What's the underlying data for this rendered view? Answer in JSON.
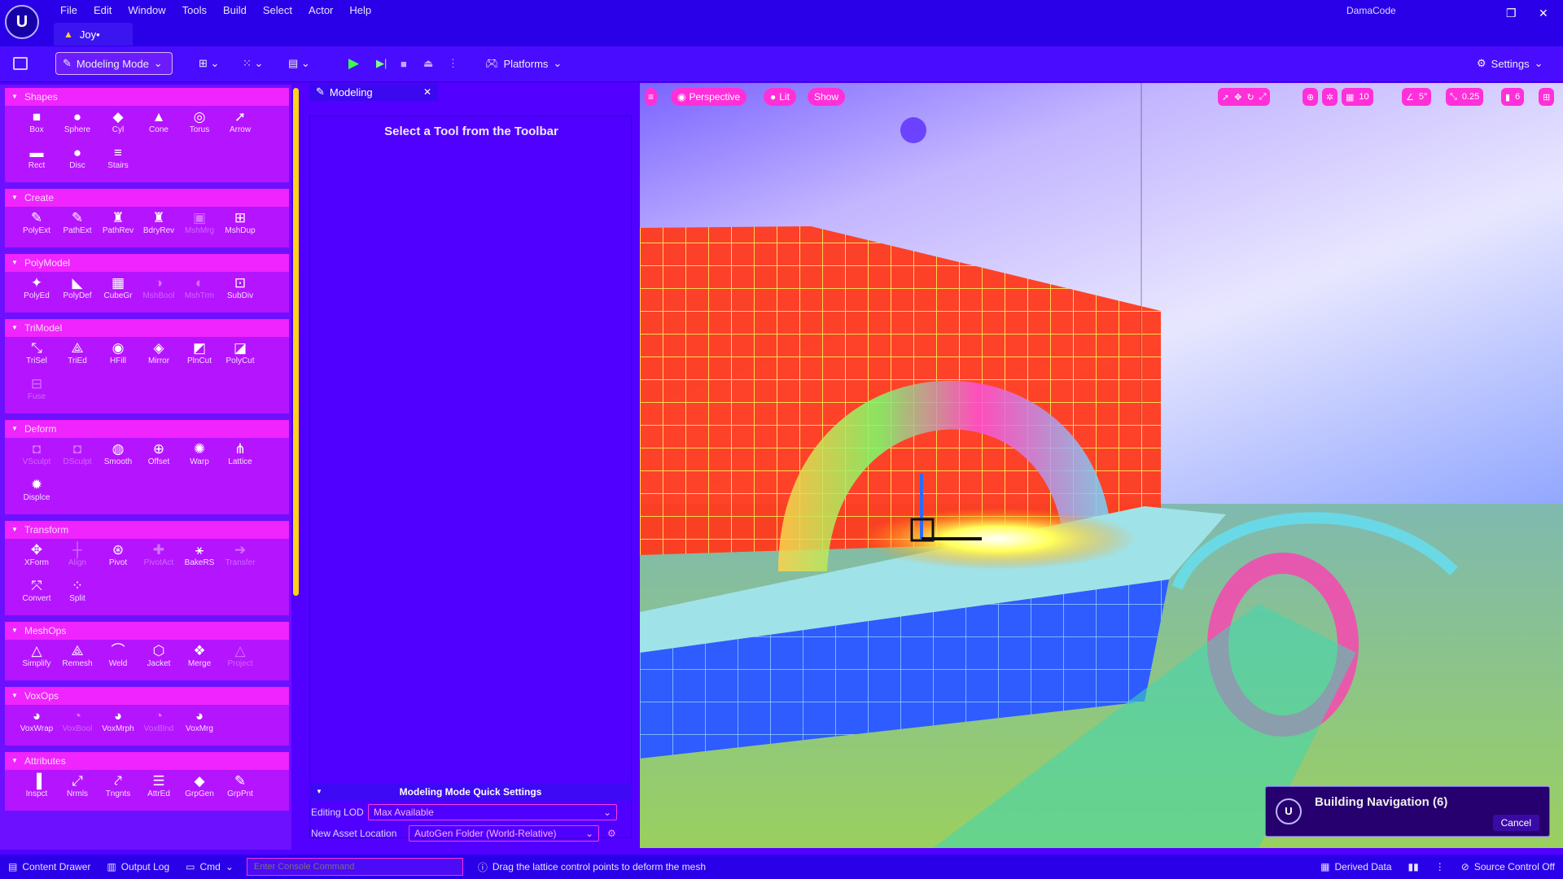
{
  "app": {
    "menu": [
      "File",
      "Edit",
      "Window",
      "Tools",
      "Build",
      "Select",
      "Actor",
      "Help"
    ],
    "document_tab": "Joy•",
    "project_name": "DamaCode"
  },
  "toolbar": {
    "mode_label": "Modeling Mode",
    "platforms_label": "Platforms",
    "settings_label": "Settings"
  },
  "palette": {
    "sections": [
      {
        "title": "Shapes",
        "tools": [
          {
            "label": "Box",
            "icon": "box-icon",
            "glyph": "■"
          },
          {
            "label": "Sphere",
            "icon": "sphere-icon",
            "glyph": "●"
          },
          {
            "label": "Cyl",
            "icon": "cylinder-icon",
            "glyph": "◆"
          },
          {
            "label": "Cone",
            "icon": "cone-icon",
            "glyph": "▲"
          },
          {
            "label": "Torus",
            "icon": "torus-icon",
            "glyph": "◎"
          },
          {
            "label": "Arrow",
            "icon": "arrow-icon",
            "glyph": "➚"
          },
          {
            "label": "Rect",
            "icon": "rect-icon",
            "glyph": "▬"
          },
          {
            "label": "Disc",
            "icon": "disc-icon",
            "glyph": "●"
          },
          {
            "label": "Stairs",
            "icon": "stairs-icon",
            "glyph": "≡"
          }
        ]
      },
      {
        "title": "Create",
        "tools": [
          {
            "label": "PolyExt",
            "icon": "pen-icon",
            "glyph": "✎"
          },
          {
            "label": "PathExt",
            "icon": "pen-icon",
            "glyph": "✎"
          },
          {
            "label": "PathRev",
            "icon": "revolve-icon",
            "glyph": "♜"
          },
          {
            "label": "BdryRev",
            "icon": "revolve-icon",
            "glyph": "♜"
          },
          {
            "label": "MshMrg",
            "icon": "merge-icon",
            "glyph": "▣",
            "dim": true
          },
          {
            "label": "MshDup",
            "icon": "duplicate-icon",
            "glyph": "⊞"
          }
        ]
      },
      {
        "title": "PolyModel",
        "tools": [
          {
            "label": "PolyEd",
            "icon": "polyedit-icon",
            "glyph": "✦"
          },
          {
            "label": "PolyDef",
            "icon": "polydeform-icon",
            "glyph": "◣"
          },
          {
            "label": "CubeGr",
            "icon": "cubegrid-icon",
            "glyph": "▦"
          },
          {
            "label": "MshBool",
            "icon": "boolean-icon",
            "glyph": "◑",
            "dim": true
          },
          {
            "label": "MshTrm",
            "icon": "trim-icon",
            "glyph": "◐",
            "dim": true
          },
          {
            "label": "SubDiv",
            "icon": "subdivide-icon",
            "glyph": "⊡"
          }
        ]
      },
      {
        "title": "TriModel",
        "tools": [
          {
            "label": "TriSel",
            "icon": "triselect-icon",
            "glyph": "⤡"
          },
          {
            "label": "TriEd",
            "icon": "triedit-icon",
            "glyph": "⟁"
          },
          {
            "label": "HFill",
            "icon": "holefill-icon",
            "glyph": "◉"
          },
          {
            "label": "Mirror",
            "icon": "mirror-icon",
            "glyph": "◈"
          },
          {
            "label": "PlnCut",
            "icon": "planecut-icon",
            "glyph": "◩"
          },
          {
            "label": "PolyCut",
            "icon": "polycut-icon",
            "glyph": "◪"
          },
          {
            "label": "Fuse",
            "icon": "fuse-icon",
            "glyph": "⊟",
            "dim": true
          }
        ]
      },
      {
        "title": "Deform",
        "tools": [
          {
            "label": "VSculpt",
            "icon": "vsculpt-icon",
            "glyph": "◘",
            "dim": true
          },
          {
            "label": "DSculpt",
            "icon": "dsculpt-icon",
            "glyph": "◘",
            "dim": true
          },
          {
            "label": "Smooth",
            "icon": "smooth-icon",
            "glyph": "◍"
          },
          {
            "label": "Offset",
            "icon": "offset-icon",
            "glyph": "⊕"
          },
          {
            "label": "Warp",
            "icon": "warp-icon",
            "glyph": "✺"
          },
          {
            "label": "Lattice",
            "icon": "lattice-icon",
            "glyph": "⋔"
          },
          {
            "label": "Displce",
            "icon": "displace-icon",
            "glyph": "✹"
          }
        ]
      },
      {
        "title": "Transform",
        "tools": [
          {
            "label": "XForm",
            "icon": "xform-icon",
            "glyph": "✥"
          },
          {
            "label": "Align",
            "icon": "align-icon",
            "glyph": "┼",
            "dim": true
          },
          {
            "label": "Pivot",
            "icon": "pivot-icon",
            "glyph": "⊛"
          },
          {
            "label": "PivotAct",
            "icon": "pivotactor-icon",
            "glyph": "✚",
            "dim": true
          },
          {
            "label": "BakeRS",
            "icon": "bake-icon",
            "glyph": "⚹"
          },
          {
            "label": "Transfer",
            "icon": "transfer-icon",
            "glyph": "➔",
            "dim": true
          },
          {
            "label": "Convert",
            "icon": "convert-icon",
            "glyph": "⤧"
          },
          {
            "label": "Split",
            "icon": "split-icon",
            "glyph": "⁘"
          }
        ]
      },
      {
        "title": "MeshOps",
        "tools": [
          {
            "label": "Simplify",
            "icon": "simplify-icon",
            "glyph": "△"
          },
          {
            "label": "Remesh",
            "icon": "remesh-icon",
            "glyph": "⟁"
          },
          {
            "label": "Weld",
            "icon": "weld-icon",
            "glyph": "⌒"
          },
          {
            "label": "Jacket",
            "icon": "jacket-icon",
            "glyph": "⬡"
          },
          {
            "label": "Merge",
            "icon": "merge-icon",
            "glyph": "❖"
          },
          {
            "label": "Project",
            "icon": "project-icon",
            "glyph": "△",
            "dim": true
          }
        ]
      },
      {
        "title": "VoxOps",
        "tools": [
          {
            "label": "VoxWrap",
            "icon": "voxwrap-icon",
            "glyph": "◕"
          },
          {
            "label": "VoxBool",
            "icon": "voxbool-icon",
            "glyph": "◔",
            "dim": true
          },
          {
            "label": "VoxMrph",
            "icon": "voxmorph-icon",
            "glyph": "◕"
          },
          {
            "label": "VoxBlnd",
            "icon": "voxblend-icon",
            "glyph": "◔",
            "dim": true
          },
          {
            "label": "VoxMrg",
            "icon": "voxmerge-icon",
            "glyph": "◕"
          }
        ]
      },
      {
        "title": "Attributes",
        "tools": [
          {
            "label": "Inspct",
            "icon": "inspect-icon",
            "glyph": "▐"
          },
          {
            "label": "Nrmls",
            "icon": "normals-icon",
            "glyph": "⤢"
          },
          {
            "label": "Tngnts",
            "icon": "tangents-icon",
            "glyph": "⤤"
          },
          {
            "label": "AttrEd",
            "icon": "attredit-icon",
            "glyph": "☰"
          },
          {
            "label": "GrpGen",
            "icon": "groupgen-icon",
            "glyph": "◆"
          },
          {
            "label": "GrpPnt",
            "icon": "grouppaint-icon",
            "glyph": "✎"
          }
        ]
      }
    ]
  },
  "details": {
    "tab_label": "Modeling",
    "message": "Select a Tool from the Toolbar",
    "quick_settings": {
      "title": "Modeling Mode Quick Settings",
      "editing_lod_label": "Editing LOD",
      "editing_lod_value": "Max Available",
      "asset_location_label": "New Asset Location",
      "asset_location_value": "AutoGen Folder (World-Relative)"
    }
  },
  "viewport": {
    "perspective_label": "Perspective",
    "lit_label": "Lit",
    "show_label": "Show",
    "grid_snap": "10",
    "rotation_snap": "5°",
    "scale_snap": "0.25",
    "camera_speed": "6"
  },
  "notification": {
    "title": "Building Navigation (6)",
    "cancel_label": "Cancel"
  },
  "statusbar": {
    "content_drawer": "Content Drawer",
    "output_log": "Output Log",
    "cmd": "Cmd",
    "cmd_placeholder": "Enter Console Command",
    "hint": "Drag the lattice control points to deform the mesh",
    "derived_data": "Derived Data",
    "source_control": "Source Control Off"
  },
  "colors": {
    "accent_magenta": "#ff2fd9",
    "section_header": "#ef24ff",
    "chrome_blue": "#2a00e8",
    "play_green": "#39ff4a"
  }
}
